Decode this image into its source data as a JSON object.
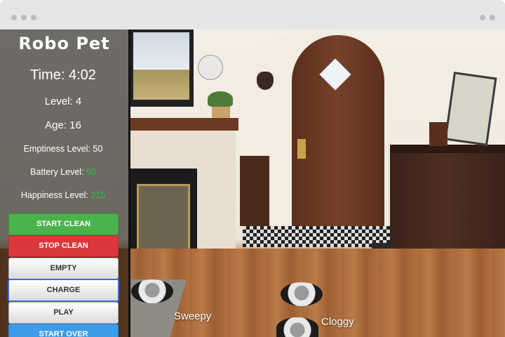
{
  "app": {
    "title": "Robo Pet"
  },
  "stats": {
    "time": "Time: 4:02",
    "level": "Level: 4",
    "age": "Age: 16",
    "emptiness_label": "Emptiness Level: 50",
    "battery_label": "Battery Level: ",
    "battery_value": "90",
    "happiness_label": "Happiness Level: ",
    "happiness_value": "215"
  },
  "buttons": {
    "start_clean": "START CLEAN",
    "stop_clean": "STOP CLEAN",
    "empty": "EMPTY",
    "charge": "CHARGE",
    "play": "PLAY",
    "start_over": "START OVER"
  },
  "robots": [
    {
      "name": "Sweepy"
    },
    {
      "name": "Cloggy"
    }
  ],
  "colors": {
    "accent_green": "#2ebd43",
    "start_clean": "#4bb34c",
    "stop_clean": "#d9393b",
    "start_over": "#3d9be8"
  }
}
